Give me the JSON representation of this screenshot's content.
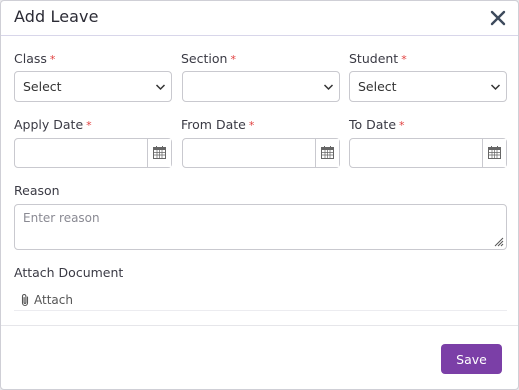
{
  "modal": {
    "title": "Add Leave",
    "close_icon": "close-icon"
  },
  "form": {
    "class": {
      "label": "Class",
      "required": "*",
      "value": "Select"
    },
    "section": {
      "label": "Section",
      "required": "*",
      "value": ""
    },
    "student": {
      "label": "Student",
      "required": "*",
      "value": "Select"
    },
    "apply_date": {
      "label": "Apply Date",
      "required": "*",
      "value": ""
    },
    "from_date": {
      "label": "From Date",
      "required": "*",
      "value": ""
    },
    "to_date": {
      "label": "To Date",
      "required": "*",
      "value": ""
    },
    "reason": {
      "label": "Reason",
      "placeholder": "Enter reason",
      "value": ""
    },
    "attach": {
      "label": "Attach Document",
      "button": "Attach"
    }
  },
  "footer": {
    "save_label": "Save"
  },
  "colors": {
    "primary": "#7b3fa7",
    "required": "#e2403f"
  }
}
